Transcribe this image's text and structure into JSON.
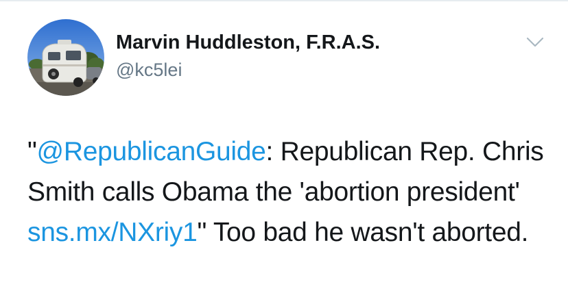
{
  "author": {
    "name": "Marvin Huddleston, F.R.A.S.",
    "handle": "@kc5lei",
    "avatar_icon": "avatar-rv-trailer-photo"
  },
  "menu": {
    "icon": "chevron-down-icon"
  },
  "tweet": {
    "quote_open": "\"",
    "mention": "@RepublicanGuide",
    "text_part1": ": Republican Rep. Chris Smith calls Obama the 'abortion president' ",
    "link": "sns.mx/NXriy1",
    "text_part2": "\" Too bad he wasn't aborted."
  },
  "colors": {
    "link": "#1b95e0",
    "handle": "#657786",
    "text": "#14171a"
  }
}
